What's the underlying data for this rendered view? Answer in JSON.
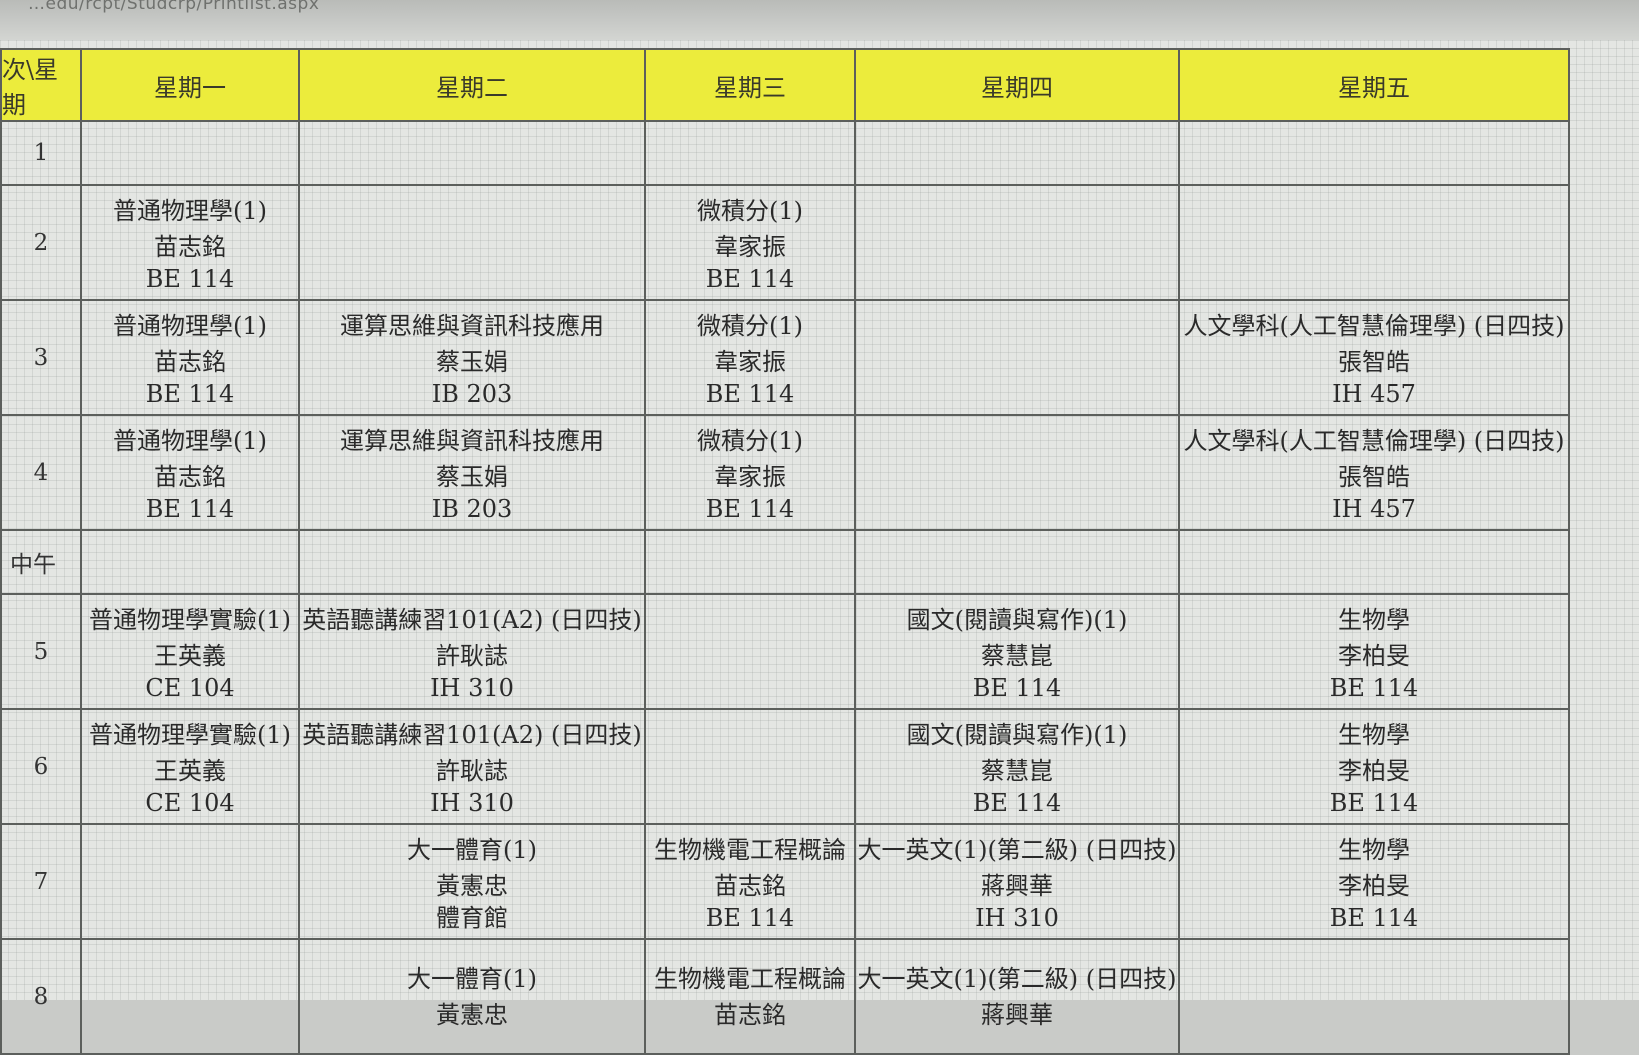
{
  "url_fragment": "…edu/rcpt/Studcrp/Printlist.aspx",
  "header": {
    "corner": "次\\星期",
    "days": [
      "星期一",
      "星期二",
      "星期三",
      "星期四",
      "星期五"
    ]
  },
  "rows": [
    {
      "period": "1",
      "cells": [
        null,
        null,
        null,
        null,
        null
      ]
    },
    {
      "period": "2",
      "cells": [
        {
          "name": "普通物理學(1)",
          "teacher": "苗志銘",
          "room": "BE 114"
        },
        null,
        {
          "name": "微積分(1)",
          "teacher": "韋家振",
          "room": "BE 114"
        },
        null,
        null
      ]
    },
    {
      "period": "3",
      "cells": [
        {
          "name": "普通物理學(1)",
          "teacher": "苗志銘",
          "room": "BE 114"
        },
        {
          "name": "運算思維與資訊科技應用",
          "teacher": "蔡玉娟",
          "room": "IB 203"
        },
        {
          "name": "微積分(1)",
          "teacher": "韋家振",
          "room": "BE 114"
        },
        null,
        {
          "name": "人文學科(人工智慧倫理學) (日四技)",
          "teacher": "張智皓",
          "room": "IH 457"
        }
      ]
    },
    {
      "period": "4",
      "cells": [
        {
          "name": "普通物理學(1)",
          "teacher": "苗志銘",
          "room": "BE 114"
        },
        {
          "name": "運算思維與資訊科技應用",
          "teacher": "蔡玉娟",
          "room": "IB 203"
        },
        {
          "name": "微積分(1)",
          "teacher": "韋家振",
          "room": "BE 114"
        },
        null,
        {
          "name": "人文學科(人工智慧倫理學) (日四技)",
          "teacher": "張智皓",
          "room": "IH 457"
        }
      ]
    },
    {
      "period": "中午",
      "cells": [
        null,
        null,
        null,
        null,
        null
      ]
    },
    {
      "period": "5",
      "cells": [
        {
          "name": "普通物理學實驗(1)",
          "teacher": "王英義",
          "room": "CE 104"
        },
        {
          "name": "英語聽講練習101(A2) (日四技)",
          "teacher": "許耿誌",
          "room": "IH 310"
        },
        null,
        {
          "name": "國文(閱讀與寫作)(1)",
          "teacher": "蔡慧崑",
          "room": "BE 114"
        },
        {
          "name": "生物學",
          "teacher": "李柏旻",
          "room": "BE 114"
        }
      ]
    },
    {
      "period": "6",
      "cells": [
        {
          "name": "普通物理學實驗(1)",
          "teacher": "王英義",
          "room": "CE 104"
        },
        {
          "name": "英語聽講練習101(A2) (日四技)",
          "teacher": "許耿誌",
          "room": "IH 310"
        },
        null,
        {
          "name": "國文(閱讀與寫作)(1)",
          "teacher": "蔡慧崑",
          "room": "BE 114"
        },
        {
          "name": "生物學",
          "teacher": "李柏旻",
          "room": "BE 114"
        }
      ]
    },
    {
      "period": "7",
      "cells": [
        null,
        {
          "name": "大一體育(1)",
          "teacher": "黃憲忠",
          "room": "體育館"
        },
        {
          "name": "生物機電工程概論",
          "teacher": "苗志銘",
          "room": "BE 114"
        },
        {
          "name": "大一英文(1)(第二級) (日四技)",
          "teacher": "蔣興華",
          "room": "IH 310"
        },
        {
          "name": "生物學",
          "teacher": "李柏旻",
          "room": "BE 114"
        }
      ]
    },
    {
      "period": "8",
      "cells": [
        null,
        {
          "name": "大一體育(1)",
          "teacher": "黃憲忠",
          "room": ""
        },
        {
          "name": "生物機電工程概論",
          "teacher": "苗志銘",
          "room": ""
        },
        {
          "name": "大一英文(1)(第二級) (日四技)",
          "teacher": "蔣興華",
          "room": ""
        },
        null
      ]
    }
  ]
}
